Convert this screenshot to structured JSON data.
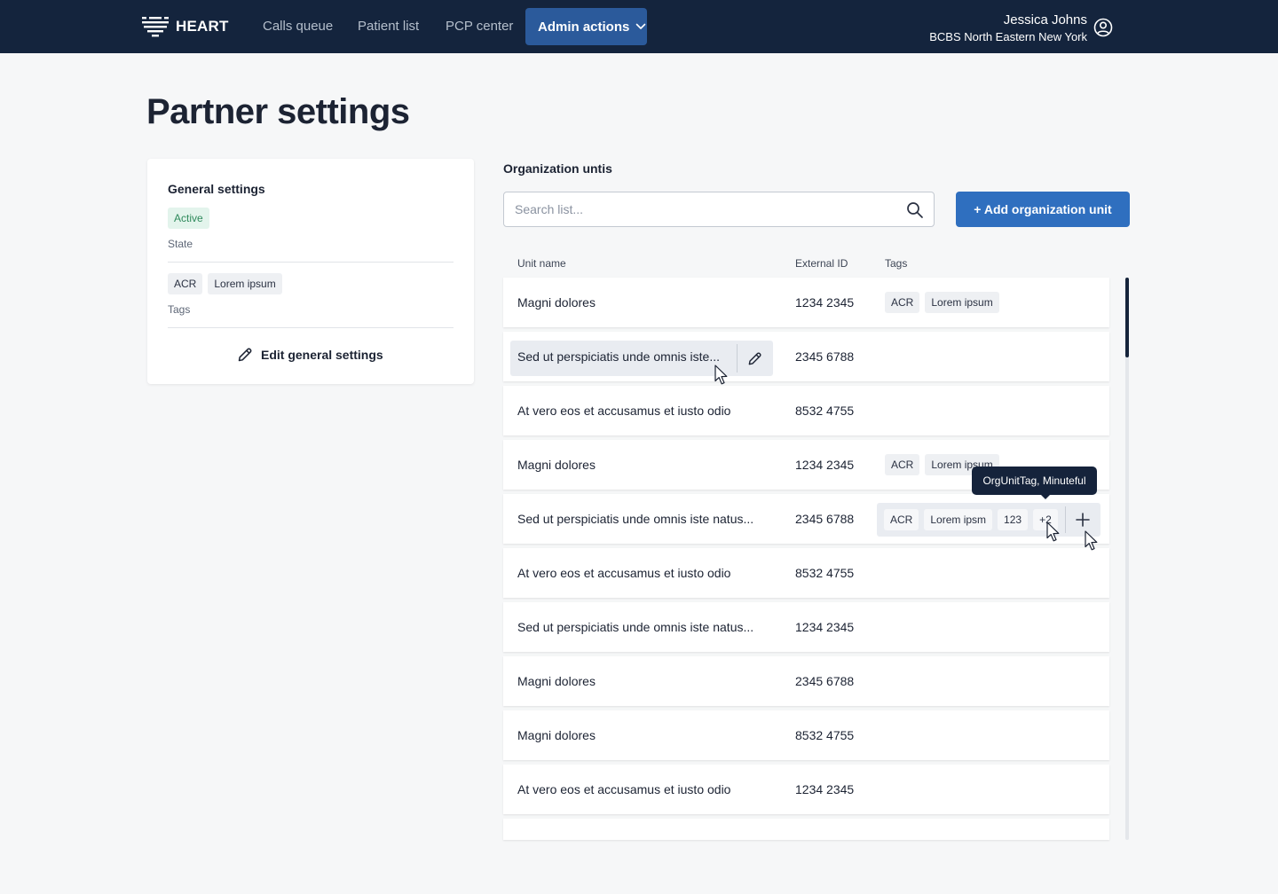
{
  "brand": {
    "name": "HEART"
  },
  "nav": {
    "items": [
      {
        "label": "Calls queue"
      },
      {
        "label": "Patient list"
      },
      {
        "label": "PCP center"
      }
    ],
    "admin": {
      "label": "Admin actions"
    }
  },
  "user": {
    "name": "Jessica Johns",
    "org": "BCBS North Eastern New York",
    "icon": "user-circle-icon"
  },
  "page": {
    "title": "Partner settings"
  },
  "general": {
    "title": "General settings",
    "state_badge": "Active",
    "state_label": "State",
    "tags": [
      "ACR",
      "Lorem ipsum"
    ],
    "tags_label": "Tags",
    "edit_label": "Edit general settings"
  },
  "org": {
    "title": "Organization untis",
    "search_placeholder": "Search list...",
    "add_label": "+ Add organization unit",
    "columns": {
      "name": "Unit name",
      "id": "External ID",
      "tags": "Tags"
    },
    "rows": [
      {
        "name": "Magni dolores",
        "id": "1234 2345",
        "tags": [
          "ACR",
          "Lorem ipsum"
        ]
      },
      {
        "name": "Sed ut perspiciatis unde omnis iste...",
        "id": "2345 6788",
        "tags": []
      },
      {
        "name": "At vero eos et accusamus et iusto odio",
        "id": "8532 4755",
        "tags": []
      },
      {
        "name": "Magni dolores",
        "id": "1234 2345",
        "tags": [
          "ACR",
          "Lorem ipsum"
        ]
      },
      {
        "name": "Sed ut perspiciatis unde omnis iste natus...",
        "id": "2345 6788",
        "tags": [
          "ACR",
          "Lorem ipsm",
          "123",
          "+2"
        ]
      },
      {
        "name": "At vero eos et accusamus et iusto odio",
        "id": "8532 4755",
        "tags": []
      },
      {
        "name": "Sed ut perspiciatis unde omnis iste natus...",
        "id": "1234 2345",
        "tags": []
      },
      {
        "name": "Magni dolores",
        "id": "2345 6788",
        "tags": []
      },
      {
        "name": "Magni dolores",
        "id": "8532 4755",
        "tags": []
      },
      {
        "name": "At vero eos et accusamus et iusto odio",
        "id": "1234 2345",
        "tags": []
      }
    ],
    "tooltip": "OrgUnitTag, Minuteful"
  },
  "colors": {
    "nav_bg": "#14243d",
    "accent": "#2f6fbf",
    "admin_active": "#2b5a9b",
    "active_badge": "#2f8a5c"
  }
}
